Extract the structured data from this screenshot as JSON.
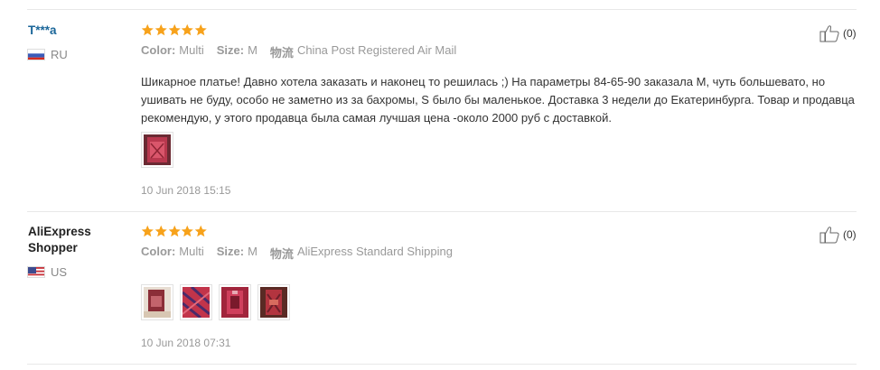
{
  "reviews": [
    {
      "user": "T***a",
      "country": "RU",
      "rating_stars": 5,
      "color_label": "Color:",
      "color_value": "Multi",
      "size_label": "Size:",
      "size_value": "M",
      "shipping_label": "物流",
      "shipping_value": "China Post Registered Air Mail",
      "text": "Шикарное платье! Давно хотела заказать и наконец то решилась ;) На параметры 84-65-90 заказала М, чуть большевато, но ушивать не буду, особо не заметно из за бахромы, S было бы маленькое. Доставка 3 недели до Екатеринбурга. Товар и продавца рекомендую, у этого продавца была самая лучшая цена -около 2000 руб с доставкой.",
      "photo_count": 1,
      "date": "10 Jun 2018 15:15",
      "helpful_count": "(0)"
    },
    {
      "user": "AliExpress Shopper",
      "country": "US",
      "rating_stars": 5,
      "color_label": "Color:",
      "color_value": "Multi",
      "size_label": "Size:",
      "size_value": "M",
      "shipping_label": "物流",
      "shipping_value": "AliExpress Standard Shipping",
      "text": "",
      "photo_count": 4,
      "date": "10 Jun 2018 07:31",
      "helpful_count": "(0)"
    }
  ],
  "colors": {
    "star": "#f7a21b",
    "username_link": "#1a6699",
    "muted": "#999999",
    "separator": "#e8e8e8"
  },
  "icons": [
    "star-icon",
    "thumbs-up-icon",
    "russia-flag-icon",
    "usa-flag-icon",
    "photo-thumbnail"
  ]
}
